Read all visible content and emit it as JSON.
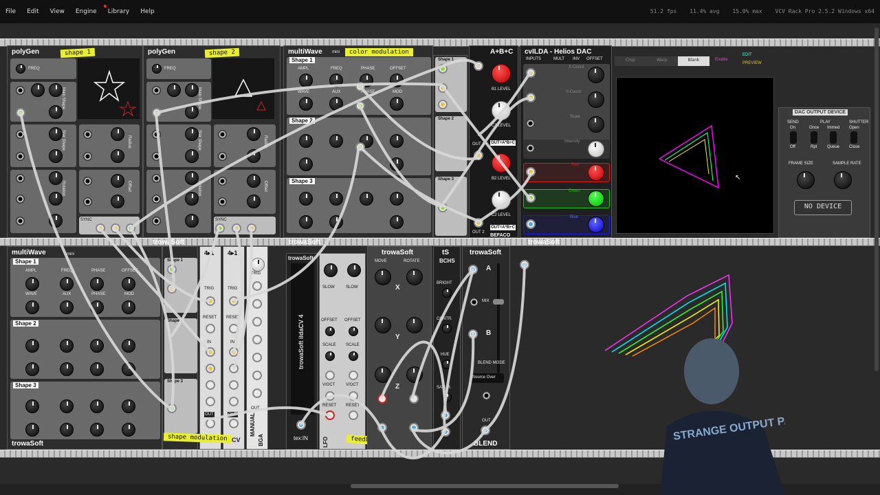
{
  "menubar": {
    "items": [
      "File",
      "Edit",
      "View",
      "Engine",
      "Library",
      "Help"
    ],
    "fps": "51.2 fps",
    "avg": "11.4% avg",
    "max": "15.0% max",
    "app": "VCV Rack Pro 2.5.2 Windows x64"
  },
  "row1": {
    "polygen1_title": "polyGen",
    "polygen2_title": "polyGen",
    "note_shape1": "shape 1",
    "note_shape2": "shape 2",
    "freq": "FREQ",
    "main_shape": "Main Shape",
    "star_shape": "Star Shape",
    "rotation": "Rotation",
    "radius": "Radius",
    "offset": "Offset",
    "sync": "SYNC",
    "multiwave_title": "multiWave",
    "mini": "mini",
    "note_color": "color modulation",
    "shape1": "Shape 1",
    "shape2": "Shape 2",
    "shape3": "Shape 3",
    "ampl": "AMPL",
    "phase": "PHASE",
    "wave": "WAVE",
    "aux": "AUX",
    "mod": "MOD",
    "abc_title": "A+B+C",
    "b1level": "B1 LEVEL",
    "c1level": "C1 LEVEL",
    "b2level": "B2 LEVEL",
    "c2level": "C2 LEVEL",
    "out1": "OUT 1",
    "out2": "OUT 2",
    "out_formula": "OUT=A*B+C",
    "befaco": "BEFACO",
    "cvilda_title": "cvILDA - Helios DAC",
    "inputs": "INPUTS",
    "mult": "MULT",
    "inv": "INV",
    "offset_h": "OFFSET",
    "xcoord": "X-Coord",
    "ycoord": "Y-Coord",
    "scale": "Scale",
    "intensity": "Intensity",
    "red": "Red",
    "green": "Green",
    "blue": "Blue",
    "tab_crop": "Crop",
    "tab_warp": "Warp",
    "tab_blank": "Blank",
    "enable": "Enable",
    "edit": "EDIT",
    "preview": "PREVIEW",
    "dac_output": "DAC OUTPUT DEVICE",
    "send": "SEND",
    "play": "PLAY",
    "shutter": "SHUTTER",
    "on": "On",
    "off": "Off",
    "once": "Once",
    "rpt": "Rpt",
    "immed": "Immed",
    "queue": "Queue",
    "open": "Open",
    "close": "Close",
    "frame_size": "FRAME SIZE",
    "sample_rate": "SAMPLE RATE",
    "no_device": "NO DEVICE",
    "trowasoft": "trowaSoft"
  },
  "row2": {
    "multiwave_title": "multiWave",
    "note_shapemod": "shape modulation",
    "note_feedback": "feedback loop",
    "trig": "TRIG",
    "reset": "RESET",
    "in": "IN",
    "out": "OUT",
    "vcv": "VCV",
    "manual": "MANUAL",
    "bga": "BGA",
    "ildacv": "trowaSoft ildaCV 4",
    "tex_in": "tex:IN",
    "slow": "SLOW",
    "offset": "OFFSET",
    "scale": "SCALE",
    "voct": "V/OCT",
    "lfo": "LFO",
    "move": "MOVE",
    "rotate": "ROTATE",
    "x": "X",
    "y": "Y",
    "z": "Z",
    "ts": "tS",
    "bchs": "BCHS",
    "bright": "BRIGHT",
    "contr": "CONTR.",
    "hue": "HUE",
    "satur": "SATUR.",
    "a": "A",
    "b": "B",
    "mix": "MIX",
    "blend_mode": "BLEND MODE",
    "source_over": "Source Over",
    "blend": "BLEND",
    "trowasoft": "trowaSoft",
    "shirt_text": "STRANGE OUTPUT PATCH CA"
  },
  "colors": {
    "note": "#e9ee33",
    "cable": "#d8d8d8",
    "red_channel": "#e01818",
    "green_channel": "#19c519",
    "blue_channel": "#1a1ae0"
  }
}
